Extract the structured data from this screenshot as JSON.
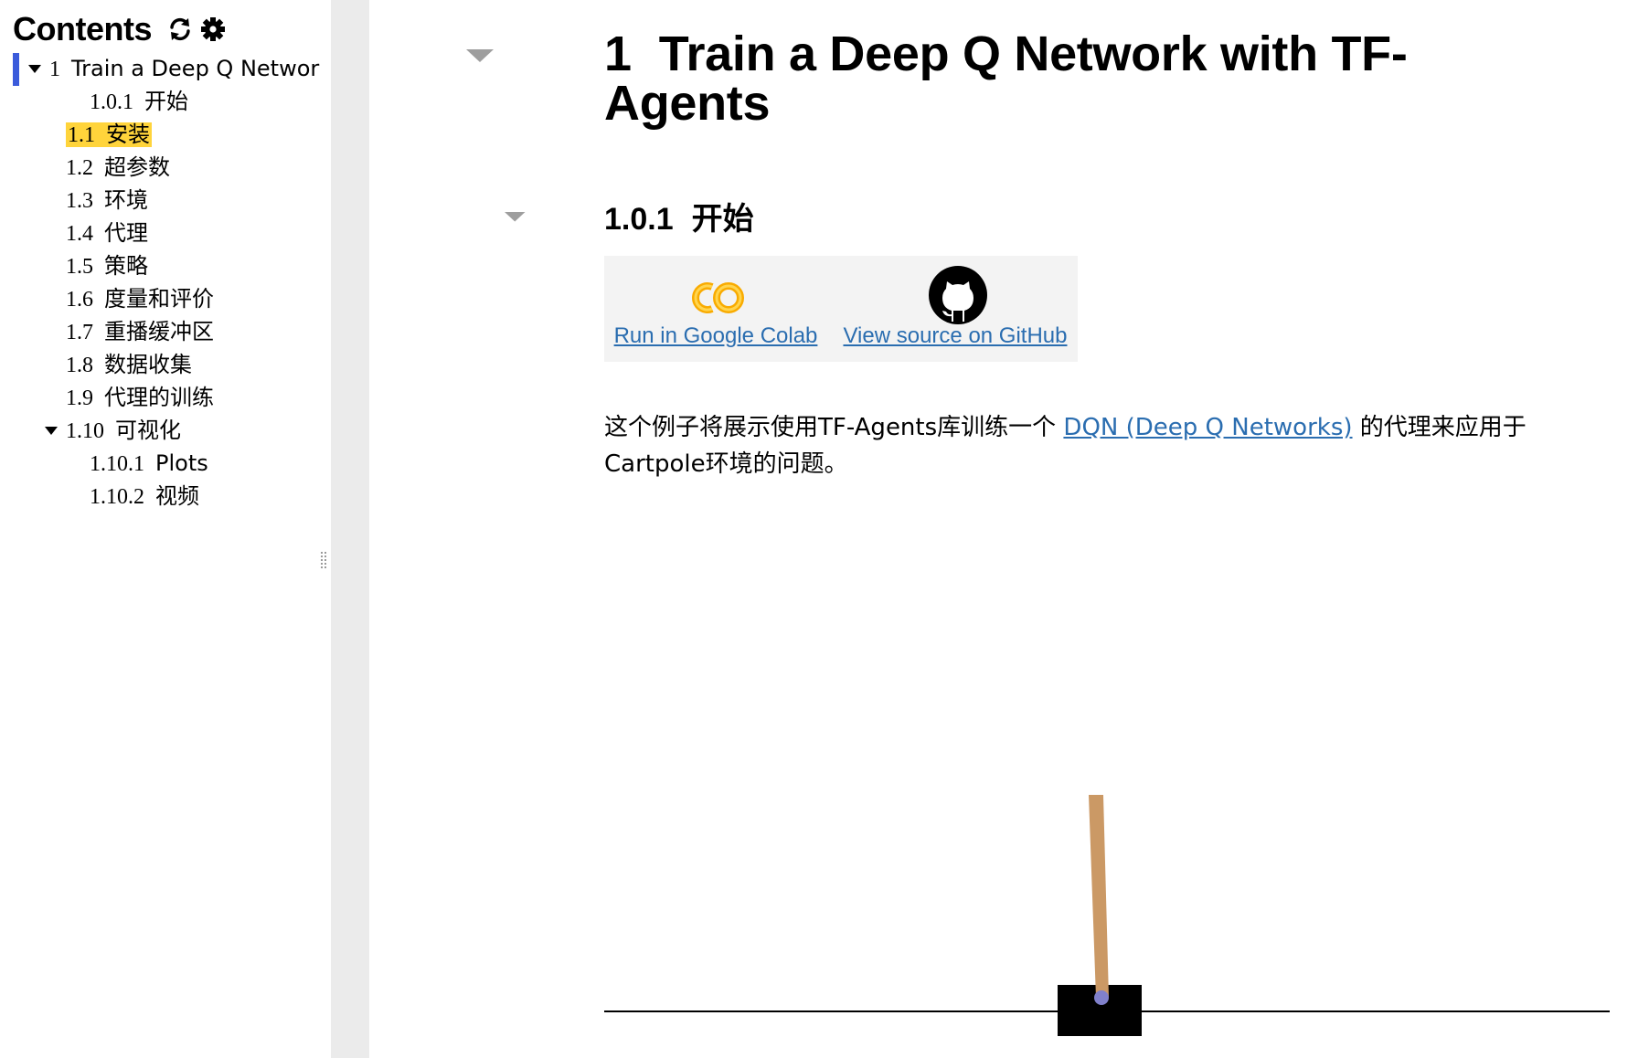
{
  "toc": {
    "title": "Contents",
    "refresh_icon": "refresh-icon",
    "settings_icon": "gear-icon",
    "items": [
      {
        "num": "1",
        "label": "Train a Deep Q Networ"
      },
      {
        "num": "1.0.1",
        "label": "开始"
      },
      {
        "num": "1.1",
        "label": "安装"
      },
      {
        "num": "1.2",
        "label": "超参数"
      },
      {
        "num": "1.3",
        "label": "环境"
      },
      {
        "num": "1.4",
        "label": "代理"
      },
      {
        "num": "1.5",
        "label": "策略"
      },
      {
        "num": "1.6",
        "label": "度量和评价"
      },
      {
        "num": "1.7",
        "label": "重播缓冲区"
      },
      {
        "num": "1.8",
        "label": "数据收集"
      },
      {
        "num": "1.9",
        "label": "代理的训练"
      },
      {
        "num": "1.10",
        "label": "可视化"
      },
      {
        "num": "1.10.1",
        "label": "Plots"
      },
      {
        "num": "1.10.2",
        "label": "视频"
      }
    ],
    "selected": "1.1"
  },
  "notebook": {
    "h1": {
      "num": "1",
      "text": "Train a Deep Q Network with TF-Agents"
    },
    "h3": {
      "num": "1.0.1",
      "text": "开始"
    },
    "links": {
      "colab_label": "Run in Google Colab",
      "github_label": "View source on GitHub",
      "colab_icon": "colab-logo",
      "github_icon": "github-logo"
    },
    "paragraph": {
      "before": "这个例子将展示使用TF-Agents库训练一个 ",
      "link": "DQN (Deep Q Networks)",
      "after": " 的代理来应用于Cartpole环境的问题。"
    }
  },
  "colors": {
    "toc_highlight": "#ffd43b",
    "active_bar": "#3b5bdb",
    "link": "#2a6db0",
    "pole": "#cb9965",
    "axle": "#8080cb",
    "cart": "#000000"
  }
}
